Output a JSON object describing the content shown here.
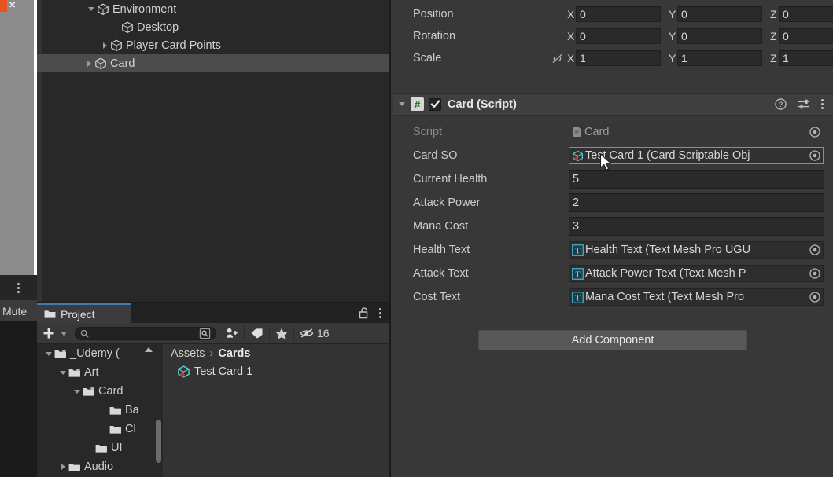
{
  "overlay": {
    "close_label": "✕",
    "mute_label": "Mute",
    "kebab_name": "more-options"
  },
  "hierarchy": {
    "rows": [
      {
        "label": "Environment",
        "indent": 76,
        "twist": "down",
        "icon": "cube-icon",
        "selected": false
      },
      {
        "label": "Desktop",
        "indent": 107,
        "twist": "none",
        "icon": "cube-icon",
        "selected": false
      },
      {
        "label": "Player Card Points",
        "indent": 93,
        "twist": "right",
        "icon": "cube-icon",
        "selected": false
      },
      {
        "label": "Card",
        "indent": 73,
        "twist": "right",
        "icon": "cube-icon",
        "selected": true
      }
    ]
  },
  "inspector": {
    "transform": {
      "rows": [
        {
          "label": "Position",
          "lock": false,
          "x": "0",
          "y": "0",
          "z": "0"
        },
        {
          "label": "Rotation",
          "lock": false,
          "x": "0",
          "y": "0",
          "z": "0"
        },
        {
          "label": "Scale",
          "lock": true,
          "x": "1",
          "y": "1",
          "z": "1"
        }
      ],
      "axis_labels": {
        "x": "X",
        "y": "Y",
        "z": "Z"
      },
      "lock_icon": "linked-scale-off-icon"
    },
    "component": {
      "title": "Card (Script)",
      "enabled": true,
      "script_glyph": "#",
      "check_glyph": "✔",
      "icons": {
        "help": "help-icon",
        "preset": "preset-icon",
        "menu": "kebab-menu-icon"
      },
      "properties": [
        {
          "name": "Script",
          "type": "object",
          "value": "Card",
          "icon": "script-file-icon",
          "dim": true,
          "readonly": true,
          "focused": false
        },
        {
          "name": "Card SO",
          "type": "object",
          "value": "Test Card 1 (Card Scriptable Obj",
          "icon": "scriptable-object-icon",
          "dim": false,
          "readonly": false,
          "focused": true
        },
        {
          "name": "Current Health",
          "type": "number",
          "value": "5"
        },
        {
          "name": "Attack Power",
          "type": "number",
          "value": "2"
        },
        {
          "name": "Mana Cost",
          "type": "number",
          "value": "3"
        },
        {
          "name": "Health Text",
          "type": "object",
          "value": "Health Text (Text Mesh Pro UGU",
          "icon": "textmeshpro-icon",
          "dim": false,
          "readonly": false,
          "focused": false
        },
        {
          "name": "Attack Text",
          "type": "object",
          "value": "Attack Power Text (Text Mesh P",
          "icon": "textmeshpro-icon",
          "dim": false,
          "readonly": false,
          "focused": false
        },
        {
          "name": "Cost Text",
          "type": "object",
          "value": "Mana Cost Text (Text Mesh Pro ",
          "icon": "textmeshpro-icon",
          "dim": false,
          "readonly": false,
          "focused": false
        }
      ]
    },
    "add_component_label": "Add Component"
  },
  "project": {
    "tab_label": "Project",
    "tab_icons": {
      "lock": "lock-open-icon",
      "menu": "kebab-menu-icon"
    },
    "toolbar": {
      "create_label": "+",
      "search_placeholder": "",
      "search_value": "",
      "hidden_count": "16",
      "icons": {
        "create": "plus-icon",
        "create_dropdown": "chevron-down-icon",
        "search": "search-icon",
        "save_search": "save-search-icon",
        "package_filter": "package-filter-icon",
        "label_filter": "label-tag-icon",
        "favorites": "star-icon",
        "hidden_toggle": "eye-off-icon"
      }
    },
    "tree": [
      {
        "label": "_Udemy (",
        "indent": 22,
        "twist": "down"
      },
      {
        "label": "Art",
        "indent": 40,
        "twist": "down"
      },
      {
        "label": "Card",
        "indent": 58,
        "twist": "down"
      },
      {
        "label": "Ba",
        "indent": 92,
        "twist": "none"
      },
      {
        "label": "Cl",
        "indent": 92,
        "twist": "none"
      },
      {
        "label": "UI",
        "indent": 74,
        "twist": "none"
      },
      {
        "label": "Audio",
        "indent": 40,
        "twist": "right"
      }
    ],
    "breadcrumb": {
      "root": "Assets",
      "separator": "›",
      "current": "Cards"
    },
    "asset": {
      "name": "Test Card 1",
      "icon": "scriptable-object-icon"
    }
  },
  "colors": {
    "panel_bg": "#383838",
    "hierarchy_bg": "#282828",
    "selection": "#4c4c4c",
    "accent_tab": "#3f7cb3",
    "text": "#cdcdcd",
    "overlay_accent": "#e8541f"
  }
}
